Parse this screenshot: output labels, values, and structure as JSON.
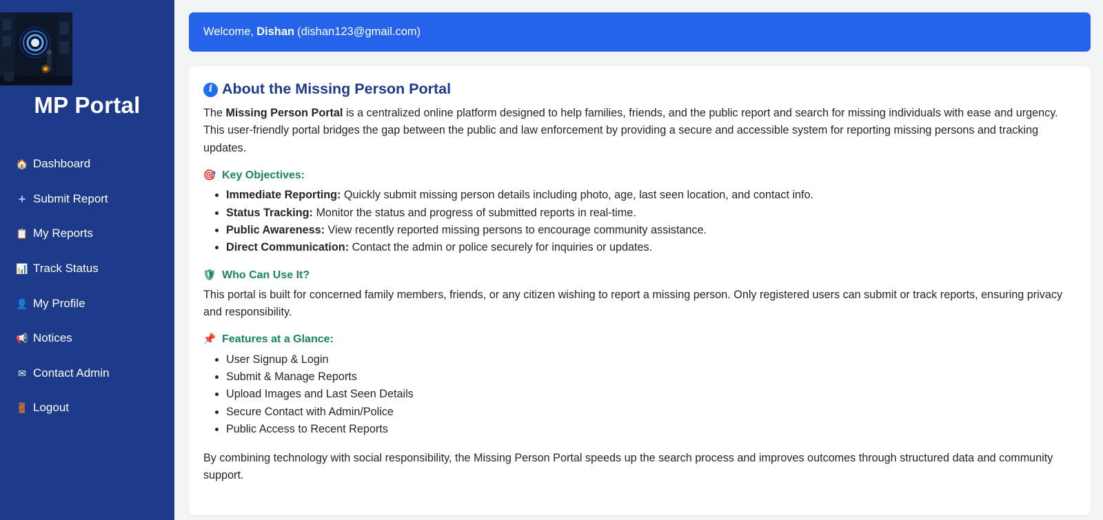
{
  "sidebar": {
    "brand": "MP Portal",
    "items": [
      {
        "label": "Dashboard",
        "icon": "house-icon"
      },
      {
        "label": "Submit Report",
        "icon": "plus-icon"
      },
      {
        "label": "My Reports",
        "icon": "clipboard-icon"
      },
      {
        "label": "Track Status",
        "icon": "bar-chart-icon"
      },
      {
        "label": "My Profile",
        "icon": "person-icon"
      },
      {
        "label": "Notices",
        "icon": "megaphone-icon"
      },
      {
        "label": "Contact Admin",
        "icon": "envelope-icon"
      },
      {
        "label": "Logout",
        "icon": "door-icon"
      }
    ]
  },
  "welcome": {
    "prefix": "Welcome,",
    "name": "Dishan",
    "email": "(dishan123@gmail.com)"
  },
  "about": {
    "title": "About the Missing Person Portal",
    "intro_prefix": "The",
    "intro_bold": "Missing Person Portal",
    "intro_rest": "is a centralized online platform designed to help families, friends, and the public report and search for missing individuals with ease and urgency. This user-friendly portal bridges the gap between the public and law enforcement by providing a secure and accessible system for reporting missing persons and tracking updates.",
    "objectives_heading": "Key Objectives:",
    "objectives": [
      {
        "term": "Immediate Reporting:",
        "desc": "Quickly submit missing person details including photo, age, last seen location, and contact info."
      },
      {
        "term": "Status Tracking:",
        "desc": "Monitor the status and progress of submitted reports in real-time."
      },
      {
        "term": "Public Awareness:",
        "desc": "View recently reported missing persons to encourage community assistance."
      },
      {
        "term": "Direct Communication:",
        "desc": "Contact the admin or police securely for inquiries or updates."
      }
    ],
    "who_heading": "Who Can Use It?",
    "who_text": "This portal is built for concerned family members, friends, or any citizen wishing to report a missing person. Only registered users can submit or track reports, ensuring privacy and responsibility.",
    "features_heading": "Features at a Glance:",
    "features": [
      "User Signup & Login",
      "Submit & Manage Reports",
      "Upload Images and Last Seen Details",
      "Secure Contact with Admin/Police",
      "Public Access to Recent Reports"
    ],
    "closing": "By combining technology with social responsibility, the Missing Person Portal speeds up the search process and improves outcomes through structured data and community support."
  },
  "colors": {
    "sidebar": "#1e3a8a",
    "welcome_bar": "#2563eb",
    "heading_blue": "#1e3a8a",
    "section_green": "#198754"
  }
}
